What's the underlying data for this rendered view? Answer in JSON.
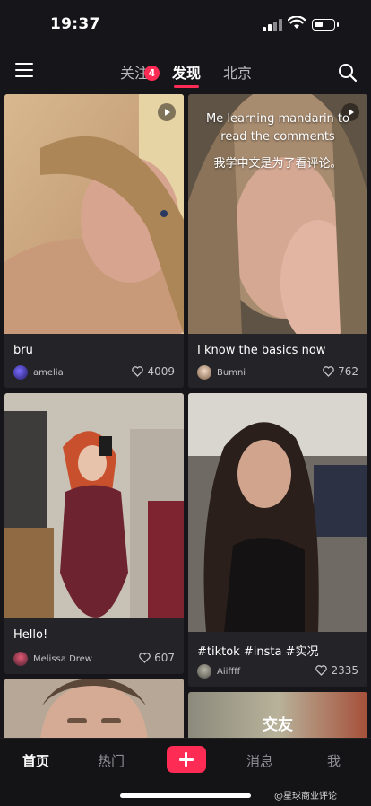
{
  "status_bar": {
    "time": "19:37"
  },
  "top_nav": {
    "tabs": [
      {
        "label": "关注",
        "badge": "4"
      },
      {
        "label": "发现"
      },
      {
        "label": "北京"
      }
    ],
    "active_tab": "发现"
  },
  "feed": [
    {
      "title": "bru",
      "user": "amelia",
      "likes": "4009",
      "overlay_text": "",
      "overlay_text_cn": ""
    },
    {
      "title": "I know the basics now",
      "user": "Bumni",
      "likes": "762",
      "overlay_text": "Me learning mandarin to read the comments",
      "overlay_text_cn": "我学中文是为了看评论。"
    },
    {
      "title": "Hello!",
      "user": "Melissa Drew",
      "likes": "607"
    },
    {
      "title": "#tiktok #insta #实况",
      "user": "Aiiffff",
      "likes": "2335"
    },
    {
      "title": "",
      "user": "",
      "likes": ""
    },
    {
      "title": "交友",
      "user": "",
      "likes": ""
    }
  ],
  "bottom_nav": {
    "items": [
      "首页",
      "热门",
      "消息",
      "我"
    ],
    "active": "首页"
  },
  "watermark": "@星球商业评论",
  "colors": {
    "accent": "#fe2c55",
    "background": "#16161a",
    "card": "#242428"
  }
}
